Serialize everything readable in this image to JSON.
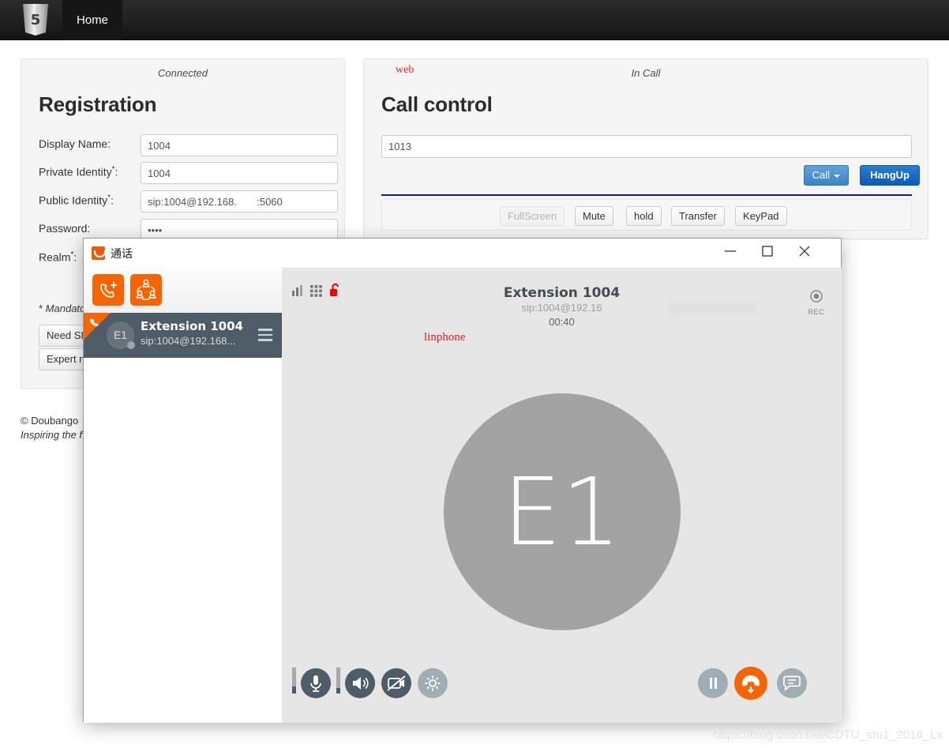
{
  "navbar": {
    "brand_icon": "html5-logo-icon",
    "home_label": "Home"
  },
  "registration": {
    "status": "Connected",
    "title": "Registration",
    "web_tag": "",
    "fields": [
      {
        "label": "Display Name:",
        "mandatory": false,
        "value": "1004"
      },
      {
        "label": "Private Identity",
        "mandatory": true,
        "value": "1004"
      },
      {
        "label": "Public Identity",
        "mandatory": true,
        "value": "sip:1004@192.168.       :5060"
      },
      {
        "label": "Password:",
        "mandatory": false,
        "value": "••••"
      },
      {
        "label": "Realm",
        "mandatory": true,
        "value": ""
      }
    ],
    "mandatory_note": "Mandato",
    "mandatory_star": "*",
    "buttons": [
      {
        "label": "Need SI"
      },
      {
        "label": "Expert m"
      }
    ]
  },
  "call_control": {
    "web_tag": "web",
    "status": "In Call",
    "title": "Call control",
    "number_value": "1013",
    "number_placeholder": "",
    "call_label": "Call",
    "hangup_label": "HangUp",
    "toolbar": [
      {
        "label": "FullScreen",
        "disabled": true
      },
      {
        "label": "Mute",
        "disabled": false
      },
      {
        "label": "hold",
        "disabled": false
      },
      {
        "label": "Transfer",
        "disabled": false
      },
      {
        "label": "KeyPad",
        "disabled": false
      }
    ]
  },
  "footer": {
    "line1": "© Doubango ",
    "line2": "Inspiring the f"
  },
  "linphone": {
    "title": "通话",
    "app_icon": "linphone-logo-icon",
    "window_buttons": {
      "minimize": "minimize-icon",
      "maximize": "maximize-icon",
      "close": "close-icon"
    },
    "sidebar": {
      "new_call_icon": "phone-add-icon",
      "conference_icon": "conference-icon",
      "contact": {
        "name": "Extension 1004",
        "sip": "sip:1004@192.168...",
        "initials": "E1",
        "incoming_icon": "phone-incoming-icon",
        "menu_icon": "hamburger-menu-icon"
      }
    },
    "call": {
      "signal_icon": "signal-bars-icon",
      "keypad_icon": "grid-keypad-icon",
      "lock_icon": "unlock-open-icon",
      "name": "Extension 1004",
      "sip": "sip:1004@192.16",
      "timer": "00:40",
      "tag": "linphone",
      "rec_label": "REC",
      "rec_icon": "record-icon",
      "avatar_initials": "E1",
      "controls_left": [
        {
          "icon": "microphone-icon",
          "style": "dark"
        },
        {
          "icon": "speaker-icon",
          "style": "dark"
        },
        {
          "icon": "camera-off-icon",
          "style": "dark"
        },
        {
          "icon": "gear-icon",
          "style": "light"
        }
      ],
      "controls_right": [
        {
          "icon": "pause-icon",
          "style": "light"
        },
        {
          "icon": "hangup-icon",
          "style": "orange"
        },
        {
          "icon": "chat-icon",
          "style": "light"
        }
      ]
    }
  },
  "watermark": "https://blog.csdn.net/CDTU_stu1_2016_Lx"
}
